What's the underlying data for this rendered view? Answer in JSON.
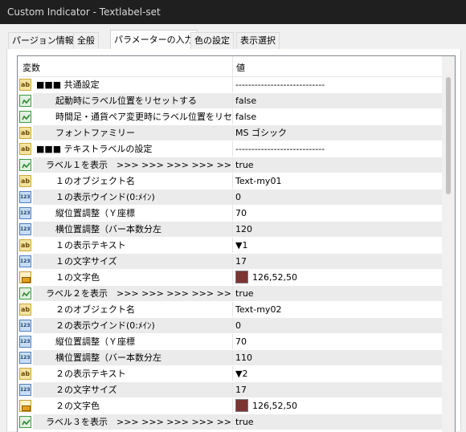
{
  "window": {
    "title": "Custom Indicator - Textlabel-set"
  },
  "tabs": [
    {
      "label": "パージョン情報"
    },
    {
      "label": "全般"
    },
    {
      "label": "パラメーターの入力"
    },
    {
      "label": "色の設定"
    },
    {
      "label": "表示選択"
    }
  ],
  "table": {
    "columns": {
      "variable": "変数",
      "value": "値"
    },
    "rows": [
      {
        "icon": "ab",
        "label": "■■■ 共通設定",
        "value": "----------------------------",
        "indent": 0
      },
      {
        "icon": "bool",
        "label": "起動時にラベル位置をリセットする",
        "value": "false",
        "indent": 2
      },
      {
        "icon": "bool",
        "label": "時間足・通貨ペア変更時にラベル位置をリセ...",
        "value": "false",
        "indent": 2
      },
      {
        "icon": "ab",
        "label": "フォントファミリー",
        "value": "MS ゴシック",
        "indent": 2
      },
      {
        "icon": "ab",
        "label": "■■■ テキストラベルの設定",
        "value": "----------------------------",
        "indent": 0
      },
      {
        "icon": "bool",
        "label": "ラベル１を表示　>>>  >>>  >>>  >>>  >>>",
        "value": "true",
        "indent": 1
      },
      {
        "icon": "ab",
        "label": "１のオブジェクト名",
        "value": "Text-my01",
        "indent": 2
      },
      {
        "icon": "num",
        "label": "１の表示ウインド(0:ﾒｲﾝ)",
        "value": "0",
        "indent": 2
      },
      {
        "icon": "num",
        "label": "縦位置調整（Ｙ座標",
        "value": "70",
        "indent": 2
      },
      {
        "icon": "num",
        "label": "横位置調整（バー本数分左",
        "value": "120",
        "indent": 2
      },
      {
        "icon": "ab",
        "label": "１の表示テキスト",
        "value": "▼1",
        "indent": 2
      },
      {
        "icon": "num",
        "label": "１の文字サイズ",
        "value": "17",
        "indent": 2
      },
      {
        "icon": "color",
        "label": "１の文字色",
        "value": "126,52,50",
        "color": "#7e3432",
        "indent": 2
      },
      {
        "icon": "bool",
        "label": "ラベル２を表示　>>>  >>>  >>>  >>>  >>>",
        "value": "true",
        "indent": 1
      },
      {
        "icon": "ab",
        "label": "２のオブジェクト名",
        "value": "Text-my02",
        "indent": 2
      },
      {
        "icon": "num",
        "label": "２の表示ウインド(0:ﾒｲﾝ)",
        "value": "0",
        "indent": 2
      },
      {
        "icon": "num",
        "label": "縦位置調整（Ｙ座標",
        "value": "70",
        "indent": 2
      },
      {
        "icon": "num",
        "label": "横位置調整（バー本数分左",
        "value": "110",
        "indent": 2
      },
      {
        "icon": "ab",
        "label": "２の表示テキスト",
        "value": "▼2",
        "indent": 2
      },
      {
        "icon": "num",
        "label": "２の文字サイズ",
        "value": "17",
        "indent": 2
      },
      {
        "icon": "color",
        "label": "２の文字色",
        "value": "126,52,50",
        "color": "#7e3432",
        "indent": 2
      },
      {
        "icon": "bool",
        "label": "ラベル３を表示　>>>  >>>  >>>  >>>  >>>",
        "value": "true",
        "indent": 1
      }
    ]
  }
}
